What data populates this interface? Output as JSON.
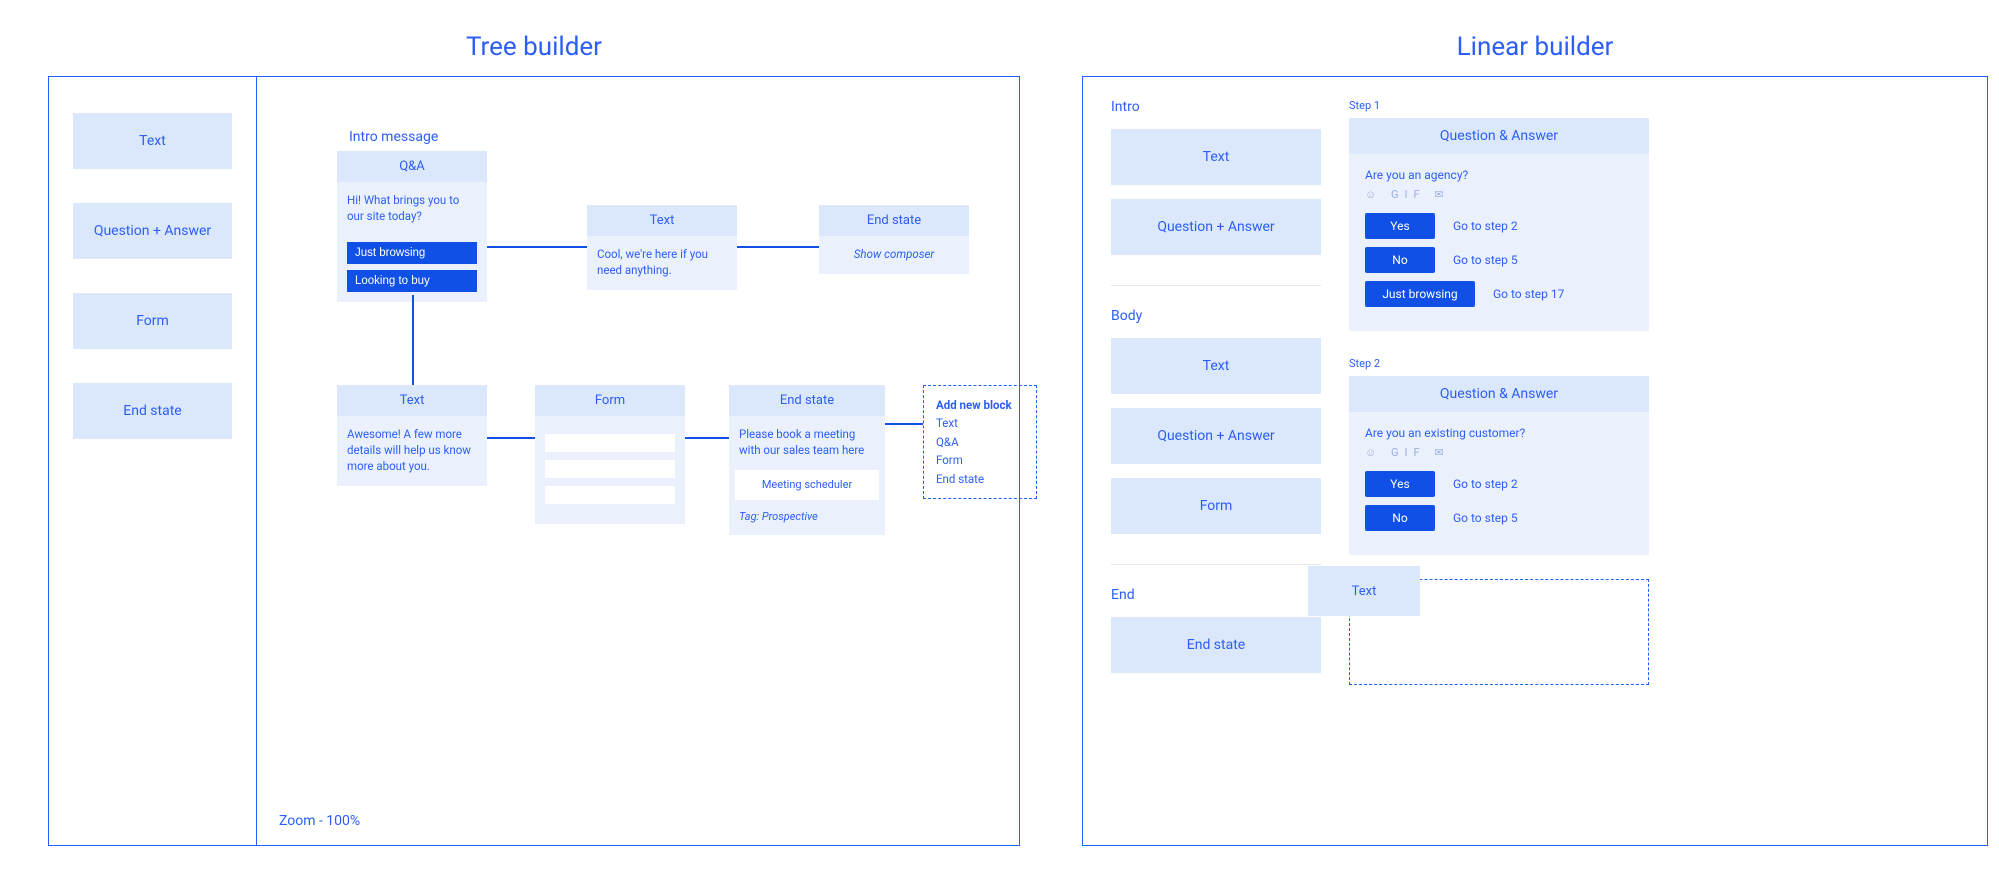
{
  "layout": {
    "tree_title": "Tree builder",
    "linear_title": "Linear builder"
  },
  "tree": {
    "palette": [
      "Text",
      "Question + Answer",
      "Form",
      "End state"
    ],
    "zoom_label": "Zoom - 100%",
    "intro_label": "Intro message",
    "nodes": {
      "qa": {
        "header": "Q&A",
        "text": "Hi! What brings you to our site today?",
        "answers": [
          "Just browsing",
          "Looking to buy"
        ]
      },
      "text1": {
        "header": "Text",
        "text": "Cool, we're here if you need anything."
      },
      "end1": {
        "header": "End state",
        "text": "Show composer"
      },
      "text2": {
        "header": "Text",
        "text": "Awesome! A few more details will help us know more about you."
      },
      "form": {
        "header": "Form"
      },
      "end2": {
        "header": "End state",
        "text": "Please book a meeting with our sales team here",
        "chip": "Meeting scheduler",
        "tag": "Tag: Prospective"
      },
      "add": {
        "title": "Add new block",
        "options": [
          "Text",
          "Q&A",
          "Form",
          "End state"
        ]
      }
    }
  },
  "linear": {
    "sections": {
      "intro": {
        "label": "Intro",
        "palette": [
          "Text",
          "Question + Answer"
        ]
      },
      "body": {
        "label": "Body",
        "palette": [
          "Text",
          "Question + Answer",
          "Form"
        ]
      },
      "end": {
        "label": "End",
        "palette": [
          "End state"
        ]
      }
    },
    "steps": [
      {
        "label": "Step 1",
        "header": "Question & Answer",
        "question": "Are you an agency?",
        "answers": [
          {
            "label": "Yes",
            "goto": "Go to step 2"
          },
          {
            "label": "No",
            "goto": "Go to step 5"
          },
          {
            "label": "Just browsing",
            "goto": "Go to step 17",
            "wide": true
          }
        ]
      },
      {
        "label": "Step 2",
        "header": "Question & Answer",
        "question": "Are you an existing customer?",
        "answers": [
          {
            "label": "Yes",
            "goto": "Go to step 2"
          },
          {
            "label": "No",
            "goto": "Go to step 5"
          }
        ]
      }
    ],
    "drag_ghost": "Text",
    "icons_label": "☺  GIF  ✉"
  }
}
